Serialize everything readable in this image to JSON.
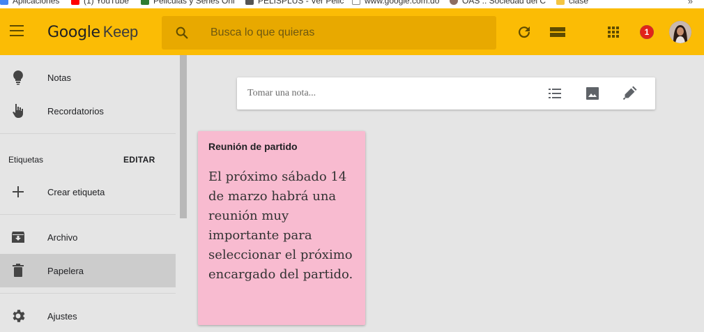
{
  "bookmarks": [
    {
      "label": "Aplicaciones",
      "icon": "apps-grid-icon",
      "color": "#4285f4"
    },
    {
      "label": "(1) YouTube",
      "icon": "youtube-icon",
      "color": "#ff0000"
    },
    {
      "label": "Peliculas y Series Onl",
      "icon": "movie-icon",
      "color": "#2e7d32"
    },
    {
      "label": "PELISPLUS - Ver Pelic",
      "icon": "page-icon",
      "color": "#555555"
    },
    {
      "label": "www.google.com.do",
      "icon": "page-icon",
      "color": "#888888"
    },
    {
      "label": "OAS :: Sociedad del C",
      "icon": "seal-icon",
      "color": "#8d6e63"
    },
    {
      "label": "clase",
      "icon": "folder-icon",
      "color": "#f4c542"
    }
  ],
  "header": {
    "app_name_google": "Google",
    "app_name_keep": "Keep",
    "search_placeholder": "Busca lo que quieras",
    "notification_count": "1",
    "accent_color": "#fbbc05"
  },
  "sidebar": {
    "items": [
      {
        "label": "Notas",
        "icon": "lightbulb-icon"
      },
      {
        "label": "Recordatorios",
        "icon": "reminder-hand-icon"
      },
      {
        "label": "Crear etiqueta",
        "icon": "plus-icon"
      },
      {
        "label": "Archivo",
        "icon": "archive-icon"
      },
      {
        "label": "Papelera",
        "icon": "trash-icon",
        "active": true
      },
      {
        "label": "Ajustes",
        "icon": "gear-icon"
      }
    ],
    "labels_heading": "Etiquetas",
    "edit_label": "EDITAR"
  },
  "take_note": {
    "placeholder": "Tomar una nota..."
  },
  "notes": [
    {
      "title": "Reunión de partido",
      "body": "El próximo sábado  14 de marzo habrá una reunión muy importante para seleccionar el próximo encargado del partido.",
      "color": "#f8bbd0"
    }
  ]
}
